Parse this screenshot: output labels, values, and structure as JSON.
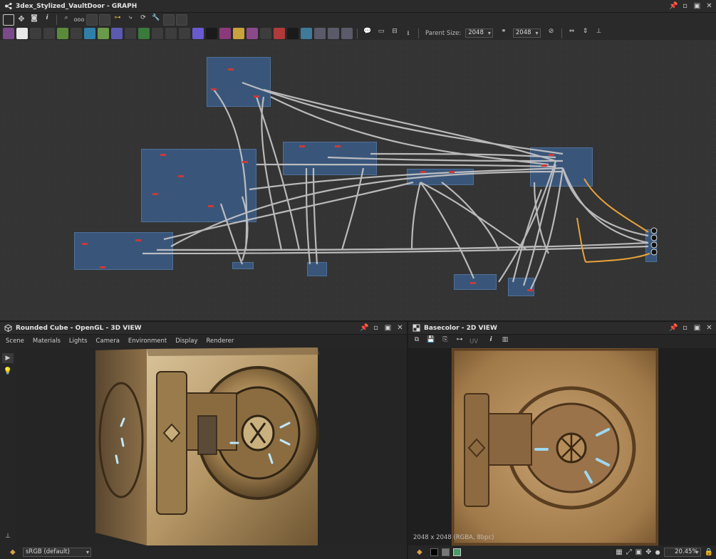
{
  "graph": {
    "title": "3dex_Stylized_VaultDoor - GRAPH",
    "parent_size_label": "Parent Size:",
    "parent_size_value": "2048",
    "size_value": "2048"
  },
  "view3d": {
    "title": "Rounded Cube - OpenGL - 3D VIEW",
    "menu": [
      "Scene",
      "Materials",
      "Lights",
      "Camera",
      "Environment",
      "Display",
      "Renderer"
    ],
    "colorspace": "sRGB (default)"
  },
  "view2d": {
    "title": "Basecolor - 2D VIEW",
    "uv_label": "UV",
    "image_info": "2048 x 2048 (RGBA, 8bpc)",
    "zoom": "20.45%"
  },
  "colors": {
    "frame": "#3c6496",
    "wire": "#c8c8c8",
    "wire_highlight": "#e8a33a",
    "metal": "#a88a5a"
  }
}
